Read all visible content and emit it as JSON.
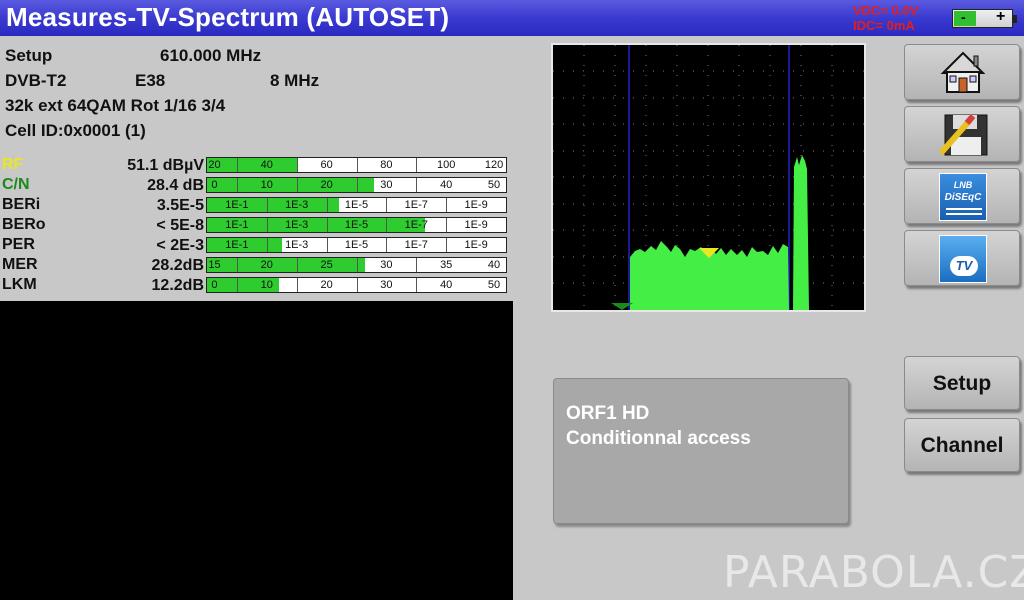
{
  "header": {
    "title": "Measures-TV-Spectrum (AUTOSET)",
    "vdc": "VDC= 0.0V",
    "idc": "IDC= 0mA",
    "battery_minus": "-",
    "battery_plus": "+"
  },
  "info": {
    "setup_label": "Setup",
    "frequency": "610.000 MHz",
    "standard": "DVB-T2",
    "channel": "E38",
    "bandwidth": "8 MHz",
    "modulation": "32k ext 64QAM Rot 1/16 3/4",
    "cell_id": "Cell ID:0x0001 (1)"
  },
  "measures": [
    {
      "label": "RF",
      "value": "51.1 dBµV",
      "label_color": "#e8e820",
      "fill": 0.3,
      "ticks": [
        "20",
        "40",
        "60",
        "80",
        "100",
        "120"
      ]
    },
    {
      "label": "C/N",
      "value": "28.4 dB",
      "label_color": "#1a8a1a",
      "fill": 0.56,
      "ticks": [
        "0",
        "10",
        "20",
        "30",
        "40",
        "50"
      ]
    },
    {
      "label": "BERi",
      "value": "3.5E-5",
      "label_color": "#111111",
      "fill": 0.44,
      "ticks": [
        "1E-1",
        "1E-3",
        "1E-5",
        "1E-7",
        "1E-9"
      ]
    },
    {
      "label": "BERo",
      "value": "< 5E-8",
      "label_color": "#111111",
      "fill": 0.73,
      "ticks": [
        "1E-1",
        "1E-3",
        "1E-5",
        "1E-7",
        "1E-9"
      ]
    },
    {
      "label": "PER",
      "value": "< 2E-3",
      "label_color": "#111111",
      "fill": 0.25,
      "ticks": [
        "1E-1",
        "1E-3",
        "1E-5",
        "1E-7",
        "1E-9"
      ]
    },
    {
      "label": "MER",
      "value": "28.2dB",
      "label_color": "#111111",
      "fill": 0.53,
      "ticks": [
        "15",
        "20",
        "25",
        "30",
        "35",
        "40"
      ]
    },
    {
      "label": "LKM",
      "value": "12.2dB",
      "label_color": "#111111",
      "fill": 0.24,
      "ticks": [
        "0",
        "10",
        "20",
        "30",
        "40",
        "50"
      ]
    }
  ],
  "buttons": {
    "home": "home-icon",
    "save": "save-icon",
    "lnb_line1": "LNB",
    "lnb_line2": "DiSEqC",
    "tv": "TV",
    "setup": "Setup",
    "channel": "Channel"
  },
  "message": {
    "line1": "ORF1 HD",
    "line2": "Conditionnal access"
  },
  "watermark": "PARABOLA.CZ",
  "colors": {
    "accent": "#3a3ad0",
    "bar_fill": "#2ecc2e",
    "spectrum": "#44ee44"
  }
}
